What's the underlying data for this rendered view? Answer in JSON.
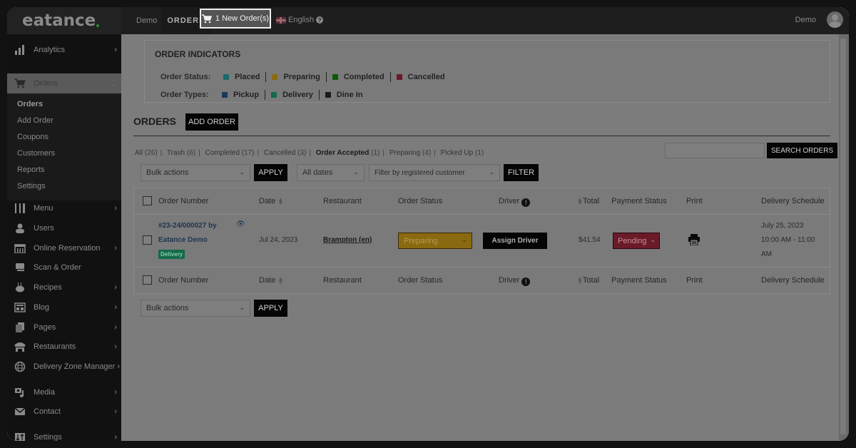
{
  "topbar": {
    "logo": "eatance",
    "demo_link": "Demo",
    "orders_link": "ORDERS",
    "new_orders": "1 New Order(s)",
    "language": "English",
    "user_name": "Demo"
  },
  "sidebar": {
    "items": [
      {
        "label": "Analytics",
        "icon": "bar-chart-icon",
        "chevron": true
      },
      {
        "label": "Orders",
        "icon": "cart-icon",
        "chevron": true,
        "active": true
      },
      {
        "label": "Menu",
        "icon": "utensils-icon",
        "chevron": true
      },
      {
        "label": "Users",
        "icon": "user-icon",
        "chevron": false
      },
      {
        "label": "Online Reservation",
        "icon": "calendar-icon",
        "chevron": true
      },
      {
        "label": "Scan & Order",
        "icon": "qr-scan-icon",
        "chevron": false
      },
      {
        "label": "Recipes",
        "icon": "cake-icon",
        "chevron": true
      },
      {
        "label": "Blog",
        "icon": "newspaper-icon",
        "chevron": true
      },
      {
        "label": "Pages",
        "icon": "pages-icon",
        "chevron": true
      },
      {
        "label": "Restaurants",
        "icon": "store-icon",
        "chevron": true
      },
      {
        "label": "Delivery Zone Manager",
        "icon": "globe-icon",
        "chevron": true
      },
      {
        "label": "Media",
        "icon": "media-icon",
        "chevron": true
      },
      {
        "label": "Contact",
        "icon": "envelope-icon",
        "chevron": true
      },
      {
        "label": "Settings",
        "icon": "sliders-icon",
        "chevron": true
      }
    ],
    "orders_submenu": [
      "Orders",
      "Add Order",
      "Coupons",
      "Customers",
      "Reports",
      "Settings"
    ]
  },
  "indicators": {
    "title": "ORDER INDICATORS",
    "status_label": "Order Status:",
    "statuses": [
      {
        "label": "Placed",
        "color": "#1a6a6a"
      },
      {
        "label": "Preparing",
        "color": "#8a6a10"
      },
      {
        "label": "Completed",
        "color": "#0a5a0a"
      },
      {
        "label": "Cancelled",
        "color": "#6a1a28"
      }
    ],
    "types_label": "Order Types:",
    "types": [
      {
        "label": "Pickup",
        "color": "#1c3a5a"
      },
      {
        "label": "Delivery",
        "color": "#156a4a"
      },
      {
        "label": "Dine In",
        "color": "#1a1a1a"
      }
    ]
  },
  "orders": {
    "title": "ORDERS",
    "add_order": "ADD ORDER",
    "filters": [
      {
        "label": "All",
        "count": "(26)",
        "active": false
      },
      {
        "label": "Trash",
        "count": "(6)",
        "active": false
      },
      {
        "label": "Completed",
        "count": "(17)",
        "active": false
      },
      {
        "label": "Cancelled",
        "count": "(3)",
        "active": false
      },
      {
        "label": "Order Accepted",
        "count": "(1)",
        "active": true
      },
      {
        "label": "Preparing",
        "count": "(4)",
        "active": false
      },
      {
        "label": "Picked Up",
        "count": "(1)",
        "active": false
      }
    ],
    "search_placeholder": "",
    "search_button": "SEARCH ORDERS",
    "bulk_actions": "Bulk actions",
    "apply": "APPLY",
    "all_dates": "All dates",
    "customer_filter": "Filter by registered customer",
    "filter": "FILTER"
  },
  "table": {
    "columns": [
      "Order Number",
      "Date",
      "Restaurant",
      "Order Status",
      "Driver",
      "Total",
      "Payment Status",
      "Print",
      "Delivery Schedule"
    ],
    "rows": [
      {
        "order_number_line1": "#23-24/000027 by",
        "order_number_line2": "Eatance Demo",
        "order_type": "Delivery",
        "date": "Jul 24, 2023",
        "restaurant": "Brampton (en)",
        "order_status": "Preparing",
        "driver_button": "Assign Driver",
        "total": "$41.54",
        "payment_status": "Pending",
        "schedule_date": "July 25, 2023",
        "schedule_time_1": "10:00 AM - 11:00",
        "schedule_time_2": "AM"
      }
    ]
  },
  "bottom": {
    "bulk_actions": "Bulk actions",
    "apply": "APPLY"
  }
}
